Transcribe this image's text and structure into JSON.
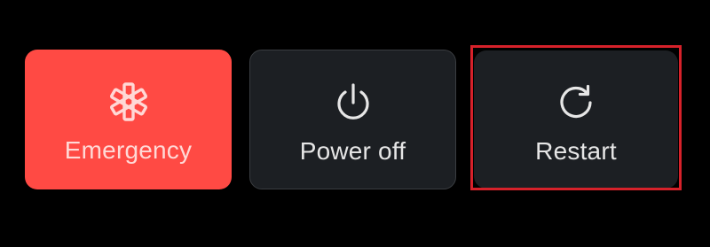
{
  "power_menu": {
    "buttons": [
      {
        "label": "Emergency",
        "icon": "medical-asterisk-icon",
        "color": "#ff4a44"
      },
      {
        "label": "Power off",
        "icon": "power-icon",
        "color": "#1c1f23"
      },
      {
        "label": "Restart",
        "icon": "restart-icon",
        "color": "#1c1f23"
      }
    ],
    "highlight_color": "#d6212a"
  }
}
